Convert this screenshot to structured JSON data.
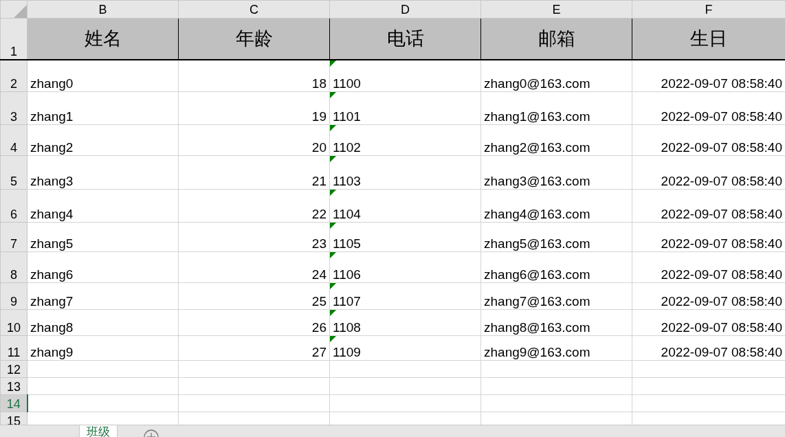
{
  "column_headers": [
    "B",
    "C",
    "D",
    "E",
    "F"
  ],
  "header_row": {
    "number": "1",
    "cells": [
      "姓名",
      "年龄",
      "电话",
      "邮箱",
      "生日"
    ]
  },
  "rows": [
    {
      "number": "2",
      "selected": false,
      "name": "zhang0",
      "age": "18",
      "phone": "1100",
      "phone_flagged": true,
      "email": "zhang0@163.com",
      "birthday": "2022-09-07 08:58:40"
    },
    {
      "number": "3",
      "selected": false,
      "name": "zhang1",
      "age": "19",
      "phone": "1101",
      "phone_flagged": true,
      "email": "zhang1@163.com",
      "birthday": "2022-09-07 08:58:40"
    },
    {
      "number": "4",
      "selected": false,
      "name": "zhang2",
      "age": "20",
      "phone": "1102",
      "phone_flagged": true,
      "email": "zhang2@163.com",
      "birthday": "2022-09-07 08:58:40"
    },
    {
      "number": "5",
      "selected": false,
      "name": "zhang3",
      "age": "21",
      "phone": "1103",
      "phone_flagged": true,
      "email": "zhang3@163.com",
      "birthday": "2022-09-07 08:58:40"
    },
    {
      "number": "6",
      "selected": false,
      "name": "zhang4",
      "age": "22",
      "phone": "1104",
      "phone_flagged": true,
      "email": "zhang4@163.com",
      "birthday": "2022-09-07 08:58:40"
    },
    {
      "number": "7",
      "selected": false,
      "name": "zhang5",
      "age": "23",
      "phone": "1105",
      "phone_flagged": true,
      "email": "zhang5@163.com",
      "birthday": "2022-09-07 08:58:40"
    },
    {
      "number": "8",
      "selected": false,
      "name": "zhang6",
      "age": "24",
      "phone": "1106",
      "phone_flagged": true,
      "email": "zhang6@163.com",
      "birthday": "2022-09-07 08:58:40"
    },
    {
      "number": "9",
      "selected": false,
      "name": "zhang7",
      "age": "25",
      "phone": "1107",
      "phone_flagged": true,
      "email": "zhang7@163.com",
      "birthday": "2022-09-07 08:58:40"
    },
    {
      "number": "10",
      "selected": false,
      "name": "zhang8",
      "age": "26",
      "phone": "1108",
      "phone_flagged": true,
      "email": "zhang8@163.com",
      "birthday": "2022-09-07 08:58:40"
    },
    {
      "number": "11",
      "selected": false,
      "name": "zhang9",
      "age": "27",
      "phone": "1109",
      "phone_flagged": true,
      "email": "zhang9@163.com",
      "birthday": "2022-09-07 08:58:40"
    },
    {
      "number": "12",
      "selected": false
    },
    {
      "number": "13",
      "selected": false
    },
    {
      "number": "14",
      "selected": true
    },
    {
      "number": "15",
      "selected": false
    }
  ],
  "sheet_tabs": [
    {
      "label": "班级",
      "selected": true
    }
  ]
}
